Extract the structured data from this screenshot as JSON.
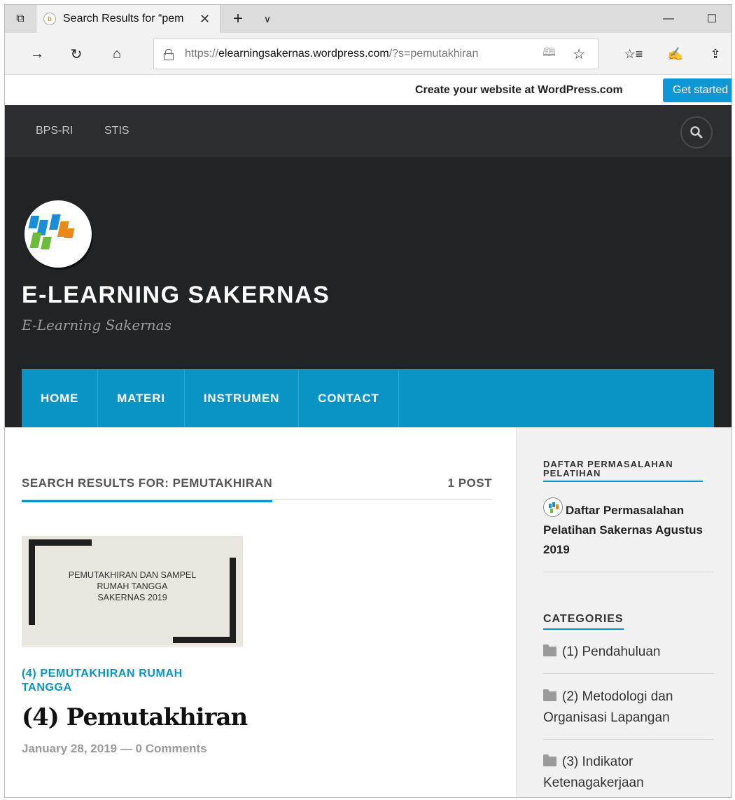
{
  "browser": {
    "tab_title": "Search Results for “pem",
    "url_prefix": "https://",
    "url_host": "elearningsakernas.wordpress.com",
    "url_path": "/?s=pemutakhiran"
  },
  "wp_banner": {
    "text": "Create your website at WordPress.com",
    "button": "Get started"
  },
  "site": {
    "top_nav": [
      "BPS-RI",
      "STIS"
    ],
    "title": "E-LEARNING SAKERNAS",
    "tagline": "E-Learning Sakernas",
    "main_nav": [
      "HOME",
      "MATERI",
      "INSTRUMEN",
      "CONTACT"
    ],
    "accent_color": "#0a93c5"
  },
  "search": {
    "title": "SEARCH RESULTS FOR: PEMUTAKHIRAN",
    "count": "1 POST"
  },
  "post": {
    "thumbnail_text": "PEMUTAKHIRAN DAN SAMPEL\nRUMAH TANGGA\nSAKERNAS 2019",
    "category": "(4) PEMUTAKHIRAN RUMAH TANGGA",
    "title": "(4) Pemutakhiran",
    "meta": "January 28, 2019 — 0 Comments"
  },
  "sidebar": {
    "widget1_title": "DAFTAR PERMASALAHAN PELATIHAN",
    "widget1_post": "Daftar Permasalahan Pelatihan Sakernas Agustus 2019",
    "categories_title": "CATEGORIES",
    "categories": [
      "(1) Pendahuluan",
      "(2) Metodologi dan Organisasi Lapangan",
      "(3) Indikator Ketenagakerjaan"
    ]
  },
  "icons": {
    "tab_actions": "tab-actions-icon",
    "close": "close-icon",
    "new_tab": "plus-icon",
    "tab_list": "chevron-down-icon",
    "minimize": "minimize-icon",
    "maximize": "maximize-icon",
    "forward": "arrow-right-icon",
    "refresh": "refresh-icon",
    "home": "home-icon",
    "lock": "lock-icon",
    "reading_view": "book-icon",
    "favorite": "star-icon",
    "favorites_hub": "favorites-list-icon",
    "notes": "pen-icon",
    "share": "share-icon",
    "search": "search-icon",
    "folder": "folder-icon"
  }
}
